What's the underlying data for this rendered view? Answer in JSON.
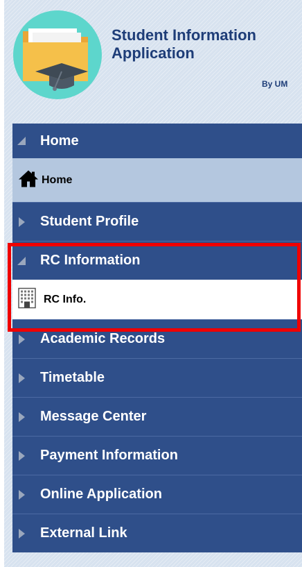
{
  "app": {
    "title_line1": "Student Information",
    "title_line2": "Application",
    "by": "By UM",
    "colors": {
      "nav_header": "#2f4f8a",
      "panel_bg": "#d7e2ef",
      "title": "#1e3d78",
      "highlight": "#f00000"
    }
  },
  "menu": {
    "home": {
      "label": "Home",
      "expanded": true,
      "items": [
        {
          "label": "Home",
          "icon": "house-icon"
        }
      ]
    },
    "student_profile": {
      "label": "Student Profile",
      "expanded": false
    },
    "rc_information": {
      "label": "RC Information",
      "expanded": true,
      "items": [
        {
          "label": "RC Info.",
          "icon": "building-icon"
        }
      ]
    },
    "academic_records": {
      "label": "Academic Records",
      "expanded": false
    },
    "timetable": {
      "label": "Timetable",
      "expanded": false
    },
    "message_center": {
      "label": "Message Center",
      "expanded": false
    },
    "payment_information": {
      "label": "Payment Information",
      "expanded": false
    },
    "online_application": {
      "label": "Online Application",
      "expanded": false
    },
    "external_link": {
      "label": "External Link",
      "expanded": false
    }
  }
}
